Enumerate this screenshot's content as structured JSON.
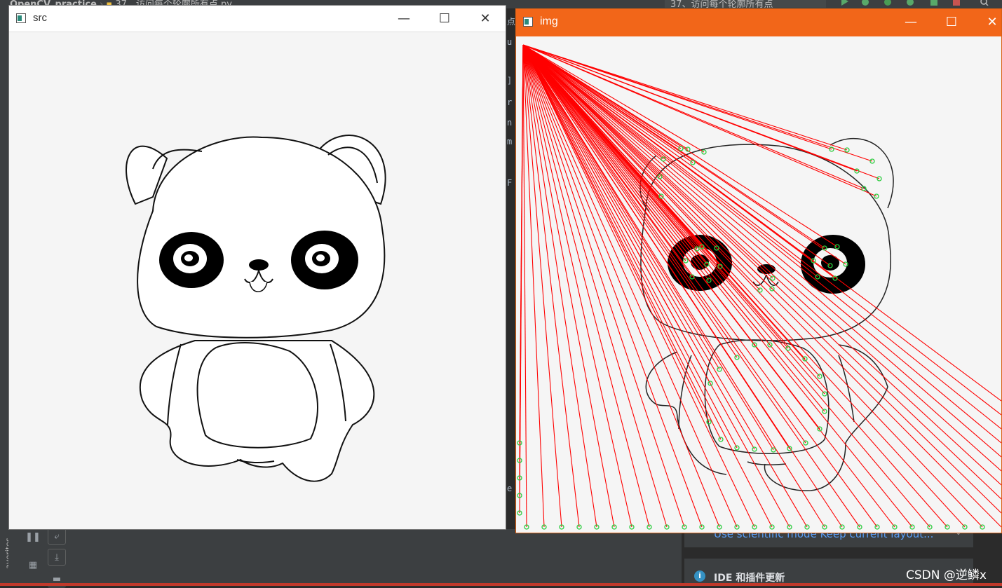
{
  "ide": {
    "project_name": "OpenCV_practice",
    "file_name": "37、访问每个轮廓所有点.py",
    "run_config": "37、访问每个轮廓所有点",
    "favorites_label": "avorites",
    "editor_chars": [
      "点",
      "u",
      "]",
      "r",
      "n",
      "m",
      "F",
      "e"
    ],
    "notification_scientific": "Use scientific mode   Keep current layout...",
    "notification_update": "IDE 和插件更新",
    "watermark": "CSDN @逆鳞x"
  },
  "windows": {
    "src": {
      "title": "src"
    },
    "img": {
      "title": "img"
    }
  },
  "colors": {
    "accent_title": "#f26619",
    "line_color": "#ff0000",
    "point_color": "#2ecc40"
  }
}
